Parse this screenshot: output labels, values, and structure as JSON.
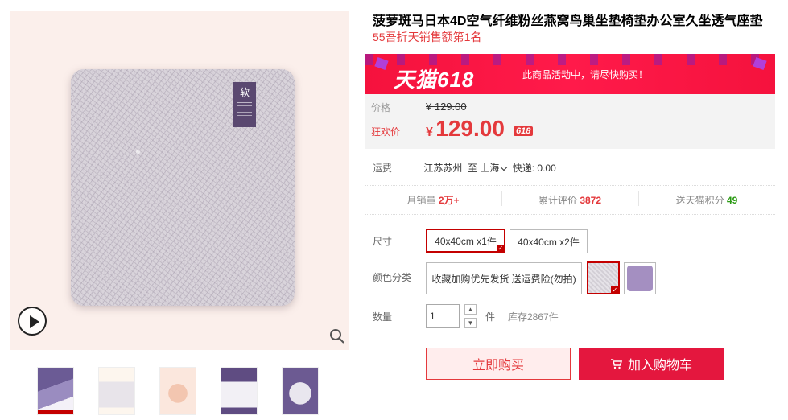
{
  "gallery": {
    "tag_text": "软",
    "thumbnails": [
      "thumb-1",
      "thumb-2",
      "thumb-3",
      "thumb-4",
      "thumb-5"
    ]
  },
  "product": {
    "title": "菠萝斑马日本4D空气纤维粉丝燕窝鸟巢坐垫椅垫办公室久坐透气座垫",
    "subtitle": "55吾折天销售额第1名"
  },
  "promo": {
    "logo": "天猫618",
    "text": "此商品活动中，请尽快购买！"
  },
  "price": {
    "label": "价格",
    "original": "¥ 129.00",
    "promo_label": "狂欢价",
    "yen": "¥",
    "promo_value": "129.00",
    "badge": "618"
  },
  "shipping": {
    "label": "运费",
    "from": "江苏苏州",
    "to_word": "至",
    "destination": "上海",
    "fee": "快递: 0.00"
  },
  "stats": {
    "monthly_sales_label": "月销量",
    "monthly_sales_value": "2万+",
    "reviews_label": "累计评价",
    "reviews_value": "3872",
    "points_label": "送天猫积分",
    "points_value": "49"
  },
  "options": {
    "size_label": "尺寸",
    "sizes": [
      "40x40cm x1件",
      "40x40cm x2件"
    ],
    "color_label": "颜色分类",
    "color_text_option": "收藏加购优先发货 送运费险(勿拍)"
  },
  "quantity": {
    "label": "数量",
    "value": "1",
    "unit": "件",
    "stock": "库存2867件"
  },
  "actions": {
    "buy_now": "立即购买",
    "add_to_cart": "加入购物车"
  },
  "colors": {
    "accent": "#e4393c",
    "tmall_red": "#f5123d",
    "price_bg": "#f3f3f3"
  }
}
